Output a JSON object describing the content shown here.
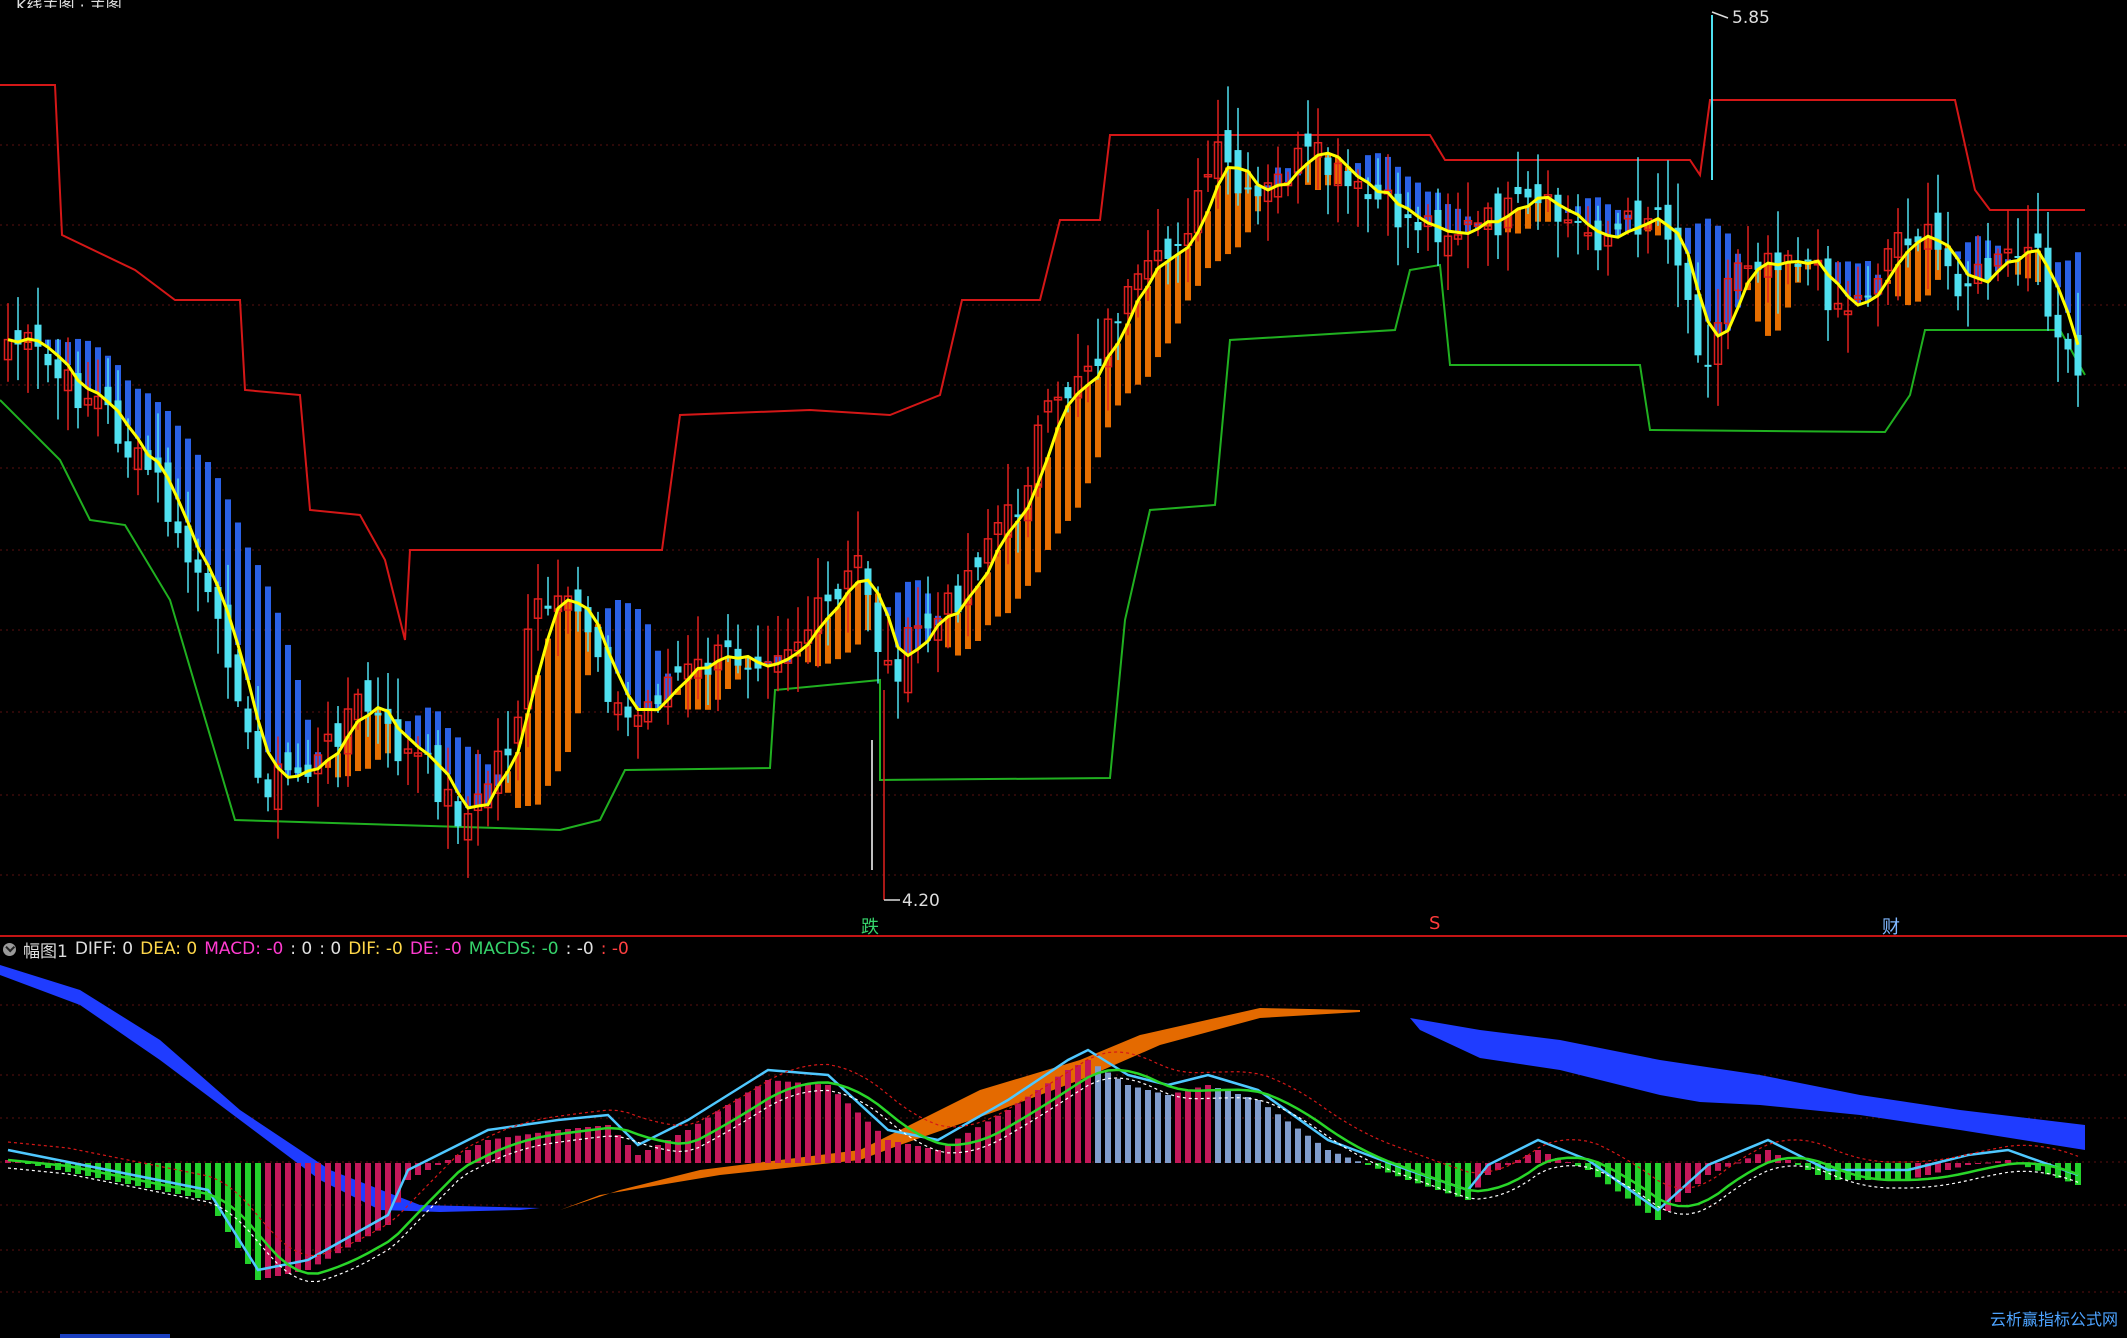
{
  "window": {
    "title_fragment": "…K线主图 · 主图"
  },
  "price_labels": {
    "high": "5.85",
    "low": "4.20"
  },
  "event_markers": [
    {
      "label": "跌",
      "color": "#36d36b",
      "position": 0.405
    },
    {
      "label": "S",
      "color": "#ff3b3b",
      "position": 0.672
    },
    {
      "label": "财",
      "color": "#7fb7ff",
      "position": 0.885
    }
  ],
  "indicator_bar": {
    "name": "幅图1",
    "items": [
      {
        "text": "DIFF: 0",
        "color": "#e0e0e0"
      },
      {
        "text": "DEA: 0",
        "color": "#ffd84a"
      },
      {
        "text": "MACD: -0",
        "color": "#ff3bd0"
      },
      {
        "text": ": 0",
        "color": "#e0e0e0"
      },
      {
        "text": ": 0",
        "color": "#e0e0e0"
      },
      {
        "text": "DIF: -0",
        "color": "#ffd84a"
      },
      {
        "text": "DE: -0",
        "color": "#ff3bd0"
      },
      {
        "text": "MACDS: -0",
        "color": "#36d36b"
      },
      {
        "text": ": -0",
        "color": "#e0e0e0"
      },
      {
        "text": ": -0",
        "color": "#ff4040"
      }
    ]
  },
  "watermark": "云析赢指标公式网",
  "colors": {
    "up_candle": "#e0201e",
    "down_candle": "#4fe0f0",
    "ma_line": "#ffff00",
    "resistance": "#d41717",
    "support": "#20b020",
    "ribbon_up": "#ff7a00",
    "ribbon_down": "#2f6bff",
    "macd_pos": "#c4185a",
    "macd_neg": "#23d12b",
    "macd_fade": "#7f9ccc",
    "diff_line": "#4fc8ff",
    "dea_line": "#29d629",
    "band_up": "#e46a00",
    "band_down": "#1f3cff"
  }
}
